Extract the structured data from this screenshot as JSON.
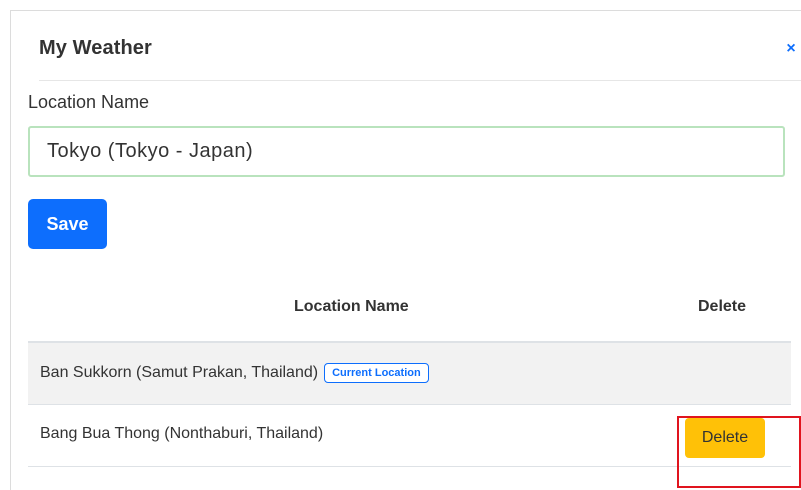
{
  "modal": {
    "title": "My Weather",
    "close_icon": "×"
  },
  "form": {
    "label": "Location Name",
    "input_value": "Tokyo (Tokyo - Japan)",
    "save_label": "Save"
  },
  "table": {
    "headers": [
      "Location Name",
      "Delete"
    ],
    "rows": [
      {
        "name": "Ban Sukkorn (Samut Prakan, Thailand)",
        "badge": "Current Location"
      },
      {
        "name": "Bang Bua Thong (Nonthaburi, Thailand)",
        "action": "Delete"
      }
    ]
  },
  "colors": {
    "primary": "#0d6efd",
    "warning": "#ffc107",
    "input_focus_border": "#b9e3bd",
    "highlight": "#e0141e"
  }
}
